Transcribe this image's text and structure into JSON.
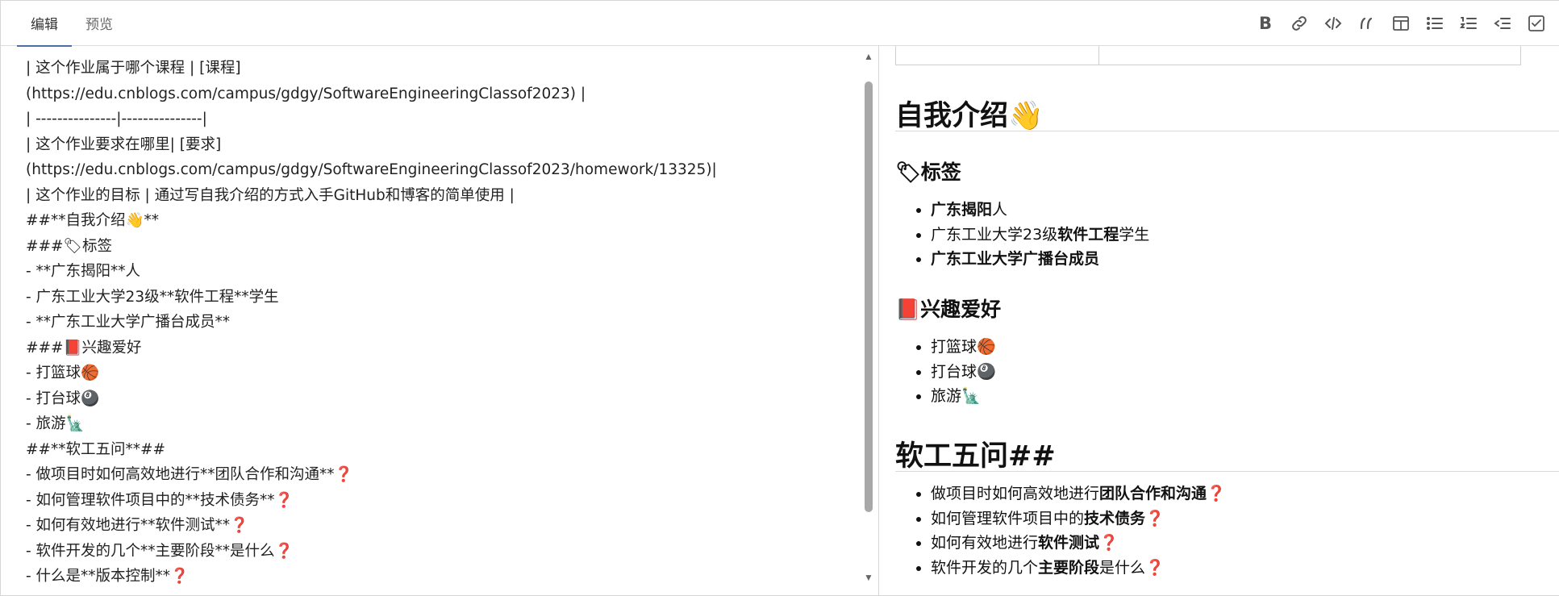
{
  "tabs": {
    "edit": "编辑",
    "preview": "预览"
  },
  "toolbar": [
    {
      "name": "bold-icon",
      "glyph": "B"
    },
    {
      "name": "link-icon"
    },
    {
      "name": "code-icon"
    },
    {
      "name": "quote-icon"
    },
    {
      "name": "table-icon"
    },
    {
      "name": "bullet-list-icon"
    },
    {
      "name": "numbered-list-icon"
    },
    {
      "name": "indent-icon"
    },
    {
      "name": "checkbox-icon"
    }
  ],
  "editor": {
    "lines": [
      "| 这个作业属于哪个课程 | [课程]",
      "(https://edu.cnblogs.com/campus/gdgy/SoftwareEngineeringClassof2023) |",
      "| ---------------|---------------|",
      "| 这个作业要求在哪里| [要求]",
      "(https://edu.cnblogs.com/campus/gdgy/SoftwareEngineeringClassof2023/homework/13325)|",
      "| 这个作业的目标 | 通过写自我介绍的方式入手GitHub和博客的简单使用 |",
      "##**自我介绍👋**",
      "###🏷标签",
      "- **广东揭阳**人",
      "- 广东工业大学23级**软件工程**学生",
      "- **广东工业大学广播台成员**",
      "###📕兴趣爱好",
      "- 打篮球🏀",
      "- 打台球🎱",
      "- 旅游🗽",
      "##**软工五问**##",
      "- 做项目时如何高效地进行**团队合作和沟通**❓",
      "- 如何管理软件项目中的**技术债务**❓",
      "- 如何有效地进行**软件测试**❓",
      "- 软件开发的几个**主要阶段**是什么❓",
      "- 什么是**版本控制**❓"
    ]
  },
  "preview": {
    "h_intro": "自我介绍👋",
    "h_tags": "🏷标签",
    "tags": [
      {
        "bold": "广东揭阳",
        "after": "人"
      },
      {
        "before": "广东工业大学23级",
        "bold": "软件工程",
        "after": "学生"
      },
      {
        "bold": "广东工业大学广播台成员"
      }
    ],
    "h_hobby": "📕兴趣爱好",
    "hobbies": [
      "打篮球🏀",
      "打台球🎱",
      "旅游🗽"
    ],
    "h_five": "软工五问##",
    "questions": [
      {
        "before": "做项目时如何高效地进行",
        "bold": "团队合作和沟通",
        "after": "❓"
      },
      {
        "before": "如何管理软件项目中的",
        "bold": "技术债务",
        "after": "❓"
      },
      {
        "before": "如何有效地进行",
        "bold": "软件测试",
        "after": "❓"
      },
      {
        "before": "软件开发的几个",
        "bold": "主要阶段",
        "after": "是什么❓"
      }
    ]
  }
}
